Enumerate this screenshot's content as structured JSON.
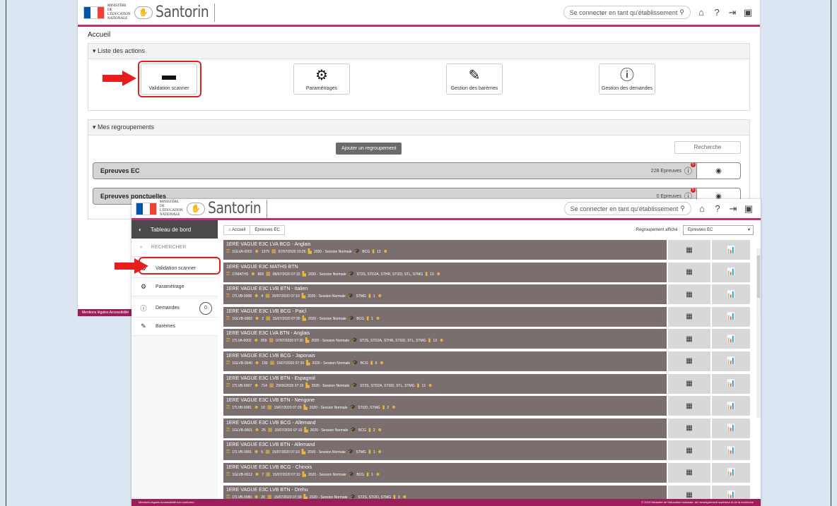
{
  "colors": {
    "brand": "#c12f78",
    "row_bg": "#7a6e6e",
    "highlight": "#e02020",
    "footer": "#9c1d5a"
  },
  "app": {
    "logo_text": "Santorin",
    "ministry_text": "MINISTÈRE DE L'ÉDUCATION NATIONALE",
    "connect_label": "Se connecter en tant qu'établissement",
    "icons": [
      "home-icon",
      "help-icon",
      "logout-icon",
      "window-icon"
    ]
  },
  "screen1": {
    "page_title": "Accueil",
    "actions_panel_title": "▾ Liste des actions",
    "actions": [
      {
        "label": "Validation scanner",
        "icon": "scanner-icon"
      },
      {
        "label": "Paramétrages",
        "icon": "gear-icon"
      },
      {
        "label": "Gestion des barèmes",
        "icon": "edit-icon"
      },
      {
        "label": "Gestion des demandes",
        "icon": "alert-icon"
      }
    ],
    "groups_panel_title": "▾ Mes regroupements",
    "add_group_label": "Ajouter un regroupement",
    "search_placeholder": "Recherche",
    "groups": [
      {
        "name": "Epreuves EC",
        "count": "228 Epreuves"
      },
      {
        "name": "Epreuves ponctuelles",
        "count": "0 Epreuves"
      }
    ],
    "footer_text": "Mentions légales   Accessibilité"
  },
  "screen2": {
    "sidebar": {
      "header": "Tableau de bord",
      "search": "RECHERCHER",
      "items": [
        {
          "label": "Validation scanner",
          "icon": "gear-icon"
        },
        {
          "label": "Paramétrage",
          "icon": "gear-icon"
        },
        {
          "label": "Demandes",
          "icon": "alert-icon",
          "badge": "0"
        },
        {
          "label": "Barèmes",
          "icon": "edit-icon"
        }
      ]
    },
    "breadcrumb": [
      "Accueil",
      "Epreuves EC"
    ],
    "regroup_label": "Regroupement affiché :",
    "regroup_value": "Epreuves EC",
    "rows": [
      {
        "title": "1ERE VAGUE E3C LVA BCG - Anglais",
        "code": "1GLVA-0002",
        "count": "1375",
        "date": "07/07/2020 10:25",
        "session": "2020 - Session Normale",
        "series": "BCG",
        "n": "12"
      },
      {
        "title": "1ERE VAGUE E3C MATHS BTN",
        "code": "1TMATHS",
        "count": "859",
        "date": "08/07/2020 07:15",
        "session": "2020 - Session Normale",
        "series": "ST2S, STD2A, STHR, STI2D, STL, STMG",
        "n": "13"
      },
      {
        "title": "1ERE VAGUE E3C LVB BTN - Italien",
        "code": "1TLVB-0008",
        "count": "4",
        "date": "20/07/2020 07:10",
        "session": "2020 - Session Normale",
        "series": "STMG",
        "n": "1"
      },
      {
        "title": "1ERE VAGUE E3C LVB BCG - Paicî",
        "code": "1GLVB-0082",
        "count": "2",
        "date": "15/07/2020 07:30",
        "session": "2020 - Session Normale",
        "series": "BCG",
        "n": "1"
      },
      {
        "title": "1ERE VAGUE E3C LVA BTN - Anglais",
        "code": "1TLVA-0002",
        "count": "859",
        "date": "07/07/2020 07:30",
        "session": "2020 - Session Normale",
        "series": "ST2S, STD2A, STHR, STI2D, STL, STMG",
        "n": "13"
      },
      {
        "title": "1ERE VAGUE E3C LVB BCG - Japonais",
        "code": "1GLVB-0040",
        "count": "190",
        "date": "15/07/2020 07:10",
        "session": "2020 - Session Normale",
        "series": "BCG",
        "n": "6"
      },
      {
        "title": "1ERE VAGUE E3C LVB BTN - Espagnol",
        "code": "1TLVB-0007",
        "count": "714",
        "date": "29/06/2020 07:10",
        "session": "2020 - Session Normale",
        "series": "ST2S, STD2A, STI2D, STL, STMG",
        "n": "12"
      },
      {
        "title": "1ERE VAGUE E3C LVB BTN - Nengone",
        "code": "1TLVB-0081",
        "count": "10",
        "date": "15/07/2020 07:20",
        "session": "2020 - Session Normale",
        "series": "STI2D, STMG",
        "n": "2"
      },
      {
        "title": "1ERE VAGUE E3C LVB BCG - Allemand",
        "code": "1GLVB-0001",
        "count": "25",
        "date": "15/07/2020 07:10",
        "session": "2020 - Session Normale",
        "series": "BCG",
        "n": "2"
      },
      {
        "title": "1ERE VAGUE E3C LVB BTN - Allemand",
        "code": "1TLVB-0001",
        "count": "5",
        "date": "15/07/2020 07:10",
        "session": "2020 - Session Normale",
        "series": "STMG",
        "n": "1"
      },
      {
        "title": "1ERE VAGUE E3C LVB BCG - Chinois",
        "code": "1GLVB-0012",
        "count": "7",
        "date": "15/07/2020 07:10",
        "session": "2020 - Session Normale",
        "series": "BCG",
        "n": "1"
      },
      {
        "title": "1ERE VAGUE E3C LVB BTN - Drehu",
        "code": "1TLVB-0080",
        "count": "20",
        "date": "15/07/2020 07:30",
        "session": "2020 - Session Normale",
        "series": "ST2S, STI2D, STMG",
        "n": "3"
      }
    ],
    "footer_left": "Mentions légales   Accessibilité non conforme",
    "footer_right": "© 2019 Ministère de l'éducation nationale, de l'enseignement supérieur et de la recherche"
  }
}
